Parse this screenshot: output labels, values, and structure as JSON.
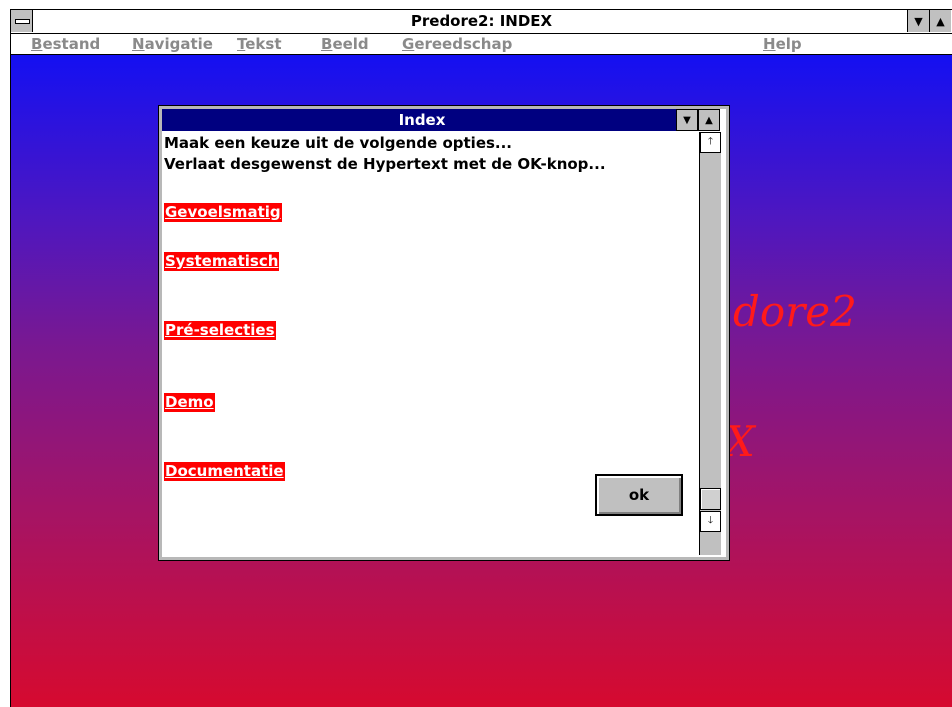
{
  "window": {
    "title": "Predore2: INDEX",
    "menu": [
      {
        "u": "B",
        "rest": "estand"
      },
      {
        "u": "N",
        "rest": "avigatie"
      },
      {
        "u": "T",
        "rest": "ekst"
      },
      {
        "u": "B",
        "rest": "eeld"
      },
      {
        "u": "G",
        "rest": "ereedschap"
      },
      {
        "u": "H",
        "rest": "elp"
      }
    ]
  },
  "background": {
    "text1": "dore2",
    "text2": "X"
  },
  "dialog": {
    "title": "Index",
    "intro1": "Maak een keuze uit de volgende opties...",
    "intro2": "Verlaat desgewenst de Hypertext met de OK-knop...",
    "links": [
      "Gevoelsmatig",
      "Systematisch",
      "Pré-selecties",
      "Demo",
      "Documentatie"
    ],
    "ok_label": "ok"
  },
  "colors": {
    "dialog_title_bg": "#000080",
    "link_bg": "#ff0000",
    "background_gradient_top": "#1410f2",
    "background_gradient_bottom": "#d60a2f"
  }
}
